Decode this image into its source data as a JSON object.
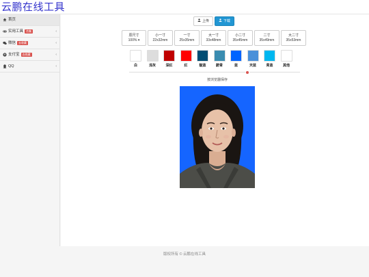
{
  "brand": "云鹏在线工具",
  "sidebar": {
    "items": [
      {
        "icon": "home-icon",
        "label": "首页",
        "badge": "",
        "chevron": ""
      },
      {
        "icon": "link-icon",
        "label": "实用工具",
        "badge": "合集",
        "chevron": "‹"
      },
      {
        "icon": "wechat-icon",
        "label": "微信",
        "badge": "去收藏",
        "chevron": "‹"
      },
      {
        "icon": "alipay-icon",
        "label": "支付宝",
        "badge": "去收藏",
        "chevron": "‹"
      },
      {
        "icon": "qq-icon",
        "label": "QQ",
        "badge": "",
        "chevron": "‹"
      }
    ]
  },
  "toolbar": {
    "upload_label": "上传",
    "download_label": "下载"
  },
  "sizes": [
    {
      "line1": "原尺寸",
      "line2": "100% ▾"
    },
    {
      "line1": "小一寸",
      "line2": "22x32mm"
    },
    {
      "line1": "一寸",
      "line2": "25x35mm"
    },
    {
      "line1": "大一寸",
      "line2": "33x48mm"
    },
    {
      "line1": "小二寸",
      "line2": "35x45mm"
    },
    {
      "line1": "二寸",
      "line2": "35x49mm"
    },
    {
      "line1": "大二寸",
      "line2": "35x53mm"
    }
  ],
  "colors": [
    {
      "label": "白",
      "hex": "#ffffff"
    },
    {
      "label": "浅灰",
      "hex": "#dddddd"
    },
    {
      "label": "深红",
      "hex": "#c00000"
    },
    {
      "label": "红",
      "hex": "#ff0000"
    },
    {
      "label": "靛蓝",
      "hex": "#004d73"
    },
    {
      "label": "蔚青",
      "hex": "#3a8cb0"
    },
    {
      "label": "蓝",
      "hex": "#0064ff"
    },
    {
      "label": "天蓝",
      "hex": "#4a90d9"
    },
    {
      "label": "青蓝",
      "hex": "#00b7f0"
    },
    {
      "label": "其他",
      "hex": "#ffffff"
    }
  ],
  "photo": {
    "caption": "按浏览器保存",
    "background": "#1565ff"
  },
  "footer": "版权所有 © 云鹏在线工具"
}
